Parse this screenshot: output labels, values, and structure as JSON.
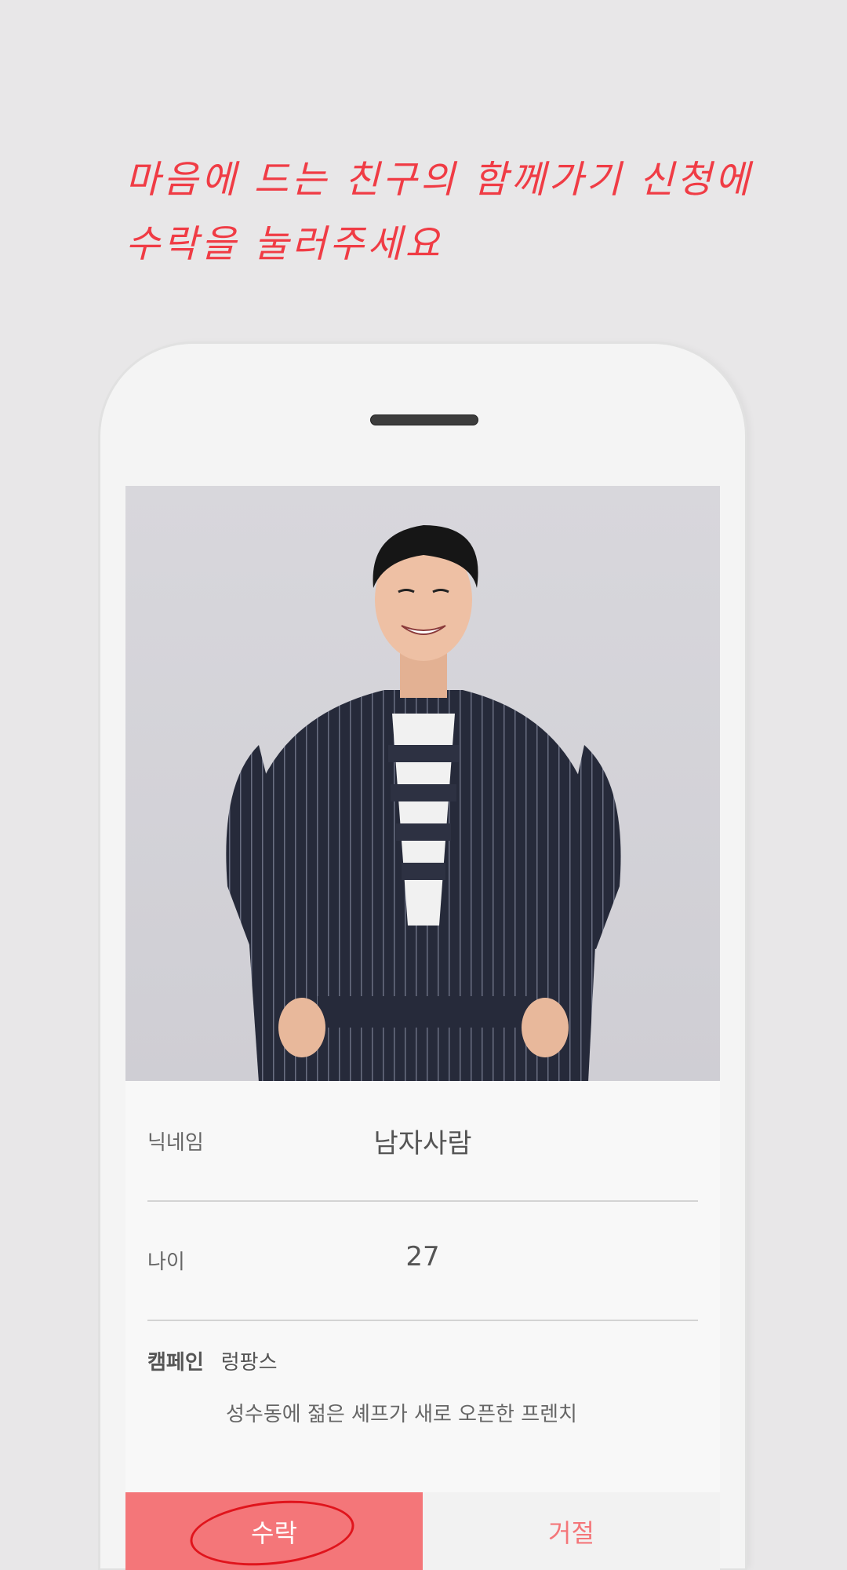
{
  "instruction": {
    "line1": "마음에 드는 친구의 함께가기 신청에",
    "line2": "수락을 눌러주세요"
  },
  "profile": {
    "nickname_label": "닉네임",
    "nickname_value": "남자사람",
    "age_label": "나이",
    "age_value": "27",
    "campaign_label": "캠페인",
    "campaign_value": "렁팡스",
    "campaign_description": "성수동에 젊은 셰프가 새로 오픈한 프렌치"
  },
  "actions": {
    "accept_label": "수락",
    "reject_label": "거절"
  },
  "colors": {
    "accent": "#f47679",
    "headline": "#f03c45",
    "background": "#e8e7e8"
  }
}
